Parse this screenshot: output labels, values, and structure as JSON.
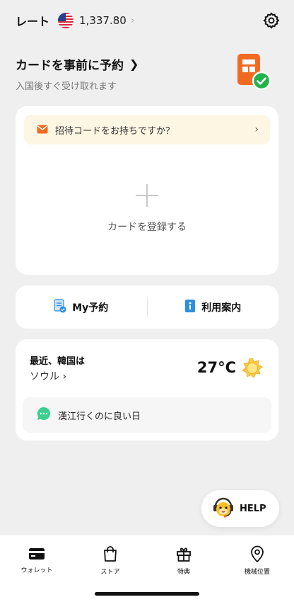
{
  "header": {
    "rate_label": "レート",
    "currency_flag": "us-flag-icon",
    "rate_value": "1,337.80",
    "settings_icon": "gear-icon"
  },
  "reserve": {
    "title": "カードを事前に予約",
    "subtitle": "入国後すぐ受け取れます"
  },
  "card_panel": {
    "invite_label": "招待コードをお持ちですか？",
    "add_card_label": "カードを登録する"
  },
  "links": {
    "my_reservation": "My予約",
    "guide": "利用案内"
  },
  "weather": {
    "title": "最近、韓国は",
    "city": "ソウル",
    "temperature": "27°C",
    "condition_icon": "sun-icon",
    "tip": "漢江行くのに良い日"
  },
  "help": {
    "label": "HELP"
  },
  "tabbar": {
    "tabs": [
      {
        "label": "ウォレット",
        "icon": "wallet-icon"
      },
      {
        "label": "ストア",
        "icon": "shopping-bag-icon"
      },
      {
        "label": "特典",
        "icon": "gift-icon"
      },
      {
        "label": "機械位置",
        "icon": "location-pin-icon"
      }
    ]
  },
  "colors": {
    "accent_orange": "#f26a21",
    "check_green": "#22b24c",
    "invite_bg": "#fdf6e3",
    "info_blue": "#2b8fe0"
  }
}
